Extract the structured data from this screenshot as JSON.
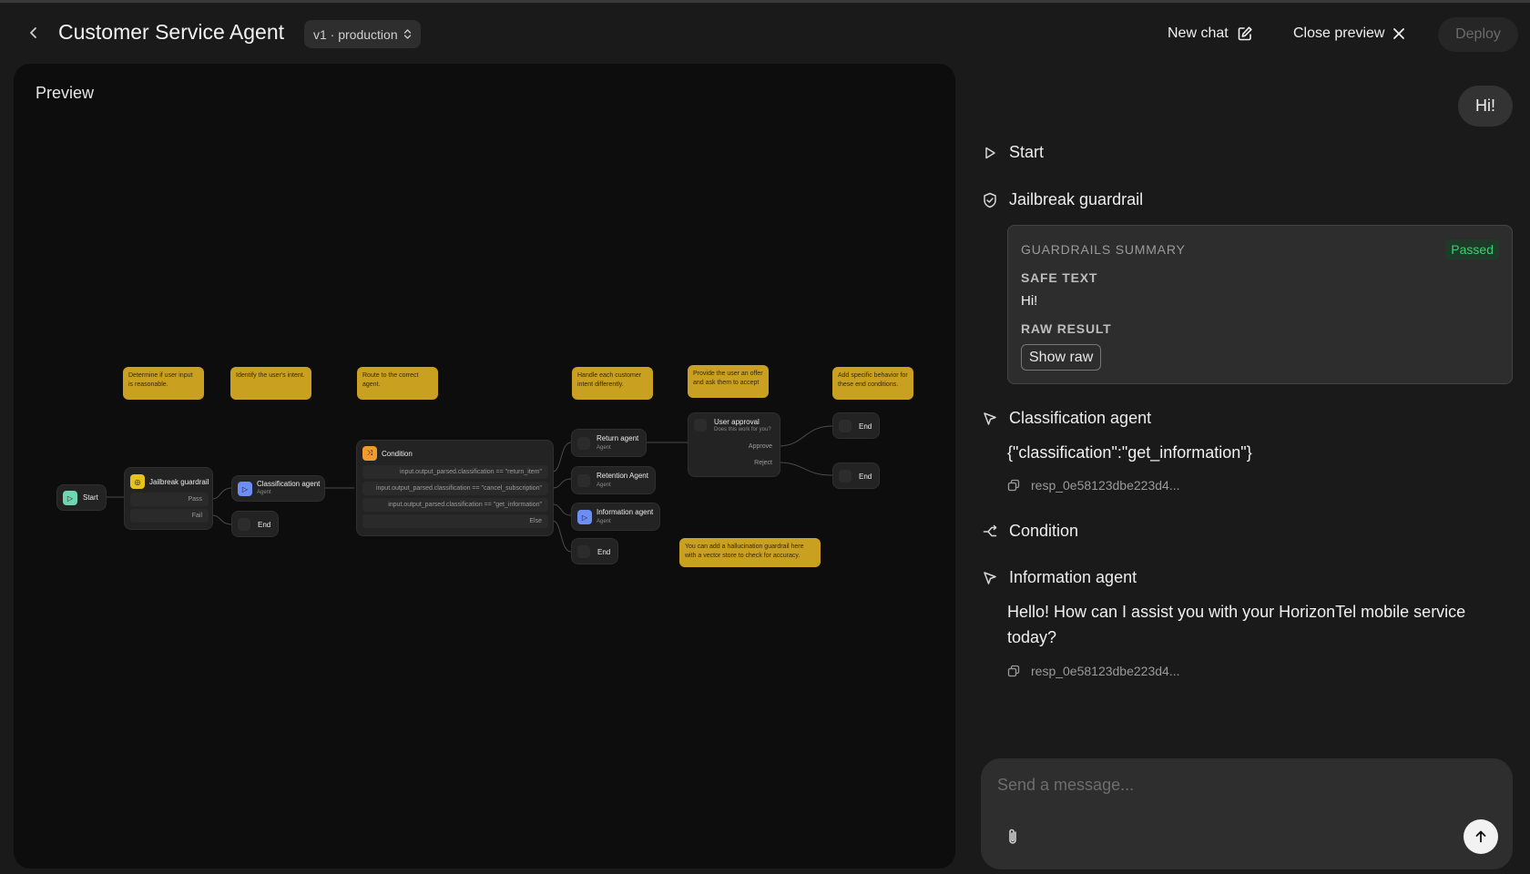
{
  "header": {
    "title": "Customer Service Agent",
    "version": "v1 · production",
    "new_chat": "New chat",
    "close_preview": "Close preview",
    "deploy": "Deploy"
  },
  "preview": {
    "label": "Preview",
    "notes": [
      "Determine if user input is reasonable.",
      "Identify the user's intent.",
      "Route to the correct agent.",
      "Handle each customer intent differently.",
      "Provide the user an offer and ask them to accept",
      "Add specific behavior for these end conditions.",
      "You can add a hallucination guardrail here with a vector store to check for accuracy."
    ],
    "nodes": {
      "start": "Start",
      "jailbreak": "Jailbreak guardrail",
      "pass": "Pass",
      "fail": "Fail",
      "classification": "Classification agent",
      "agent_sub": "Agent",
      "end": "End",
      "condition": "Condition",
      "cond_rows": [
        "input.output_parsed.classification == \"return_item\"",
        "input.output_parsed.classification == \"cancel_subscription\"",
        "input.output_parsed.classification == \"get_information\"",
        "Else"
      ],
      "return_agent": "Return agent",
      "retention_agent": "Retention Agent",
      "information_agent": "Information agent",
      "user_approval": "User approval",
      "approval_sub": "Does this work for you?",
      "approve": "Approve",
      "reject": "Reject"
    }
  },
  "chat": {
    "user_message": "Hi!",
    "steps": {
      "start": "Start",
      "jailbreak": "Jailbreak guardrail",
      "classification": "Classification agent",
      "condition": "Condition",
      "information": "Information agent"
    },
    "guardrails": {
      "summary_label": "GUARDRAILS SUMMARY",
      "status": "Passed",
      "safe_text_label": "SAFE TEXT",
      "safe_text": "Hi!",
      "raw_result_label": "RAW RESULT",
      "show_raw": "Show raw"
    },
    "classification_output": "{\"classification\":\"get_information\"}",
    "response_id_1": "resp_0e58123dbe223d4...",
    "answer": "Hello! How can I assist you with your HorizonTel mobile service today?",
    "response_id_2": "resp_0e58123dbe223d4...",
    "composer_placeholder": "Send a message..."
  },
  "colors": {
    "note": "#c9a020",
    "passed": "#3fcf72",
    "start_icon": "#6fd6b0",
    "guard_icon": "#e6c21f",
    "agent_icon": "#6d8ff5",
    "condition_icon": "#f29a2e"
  }
}
